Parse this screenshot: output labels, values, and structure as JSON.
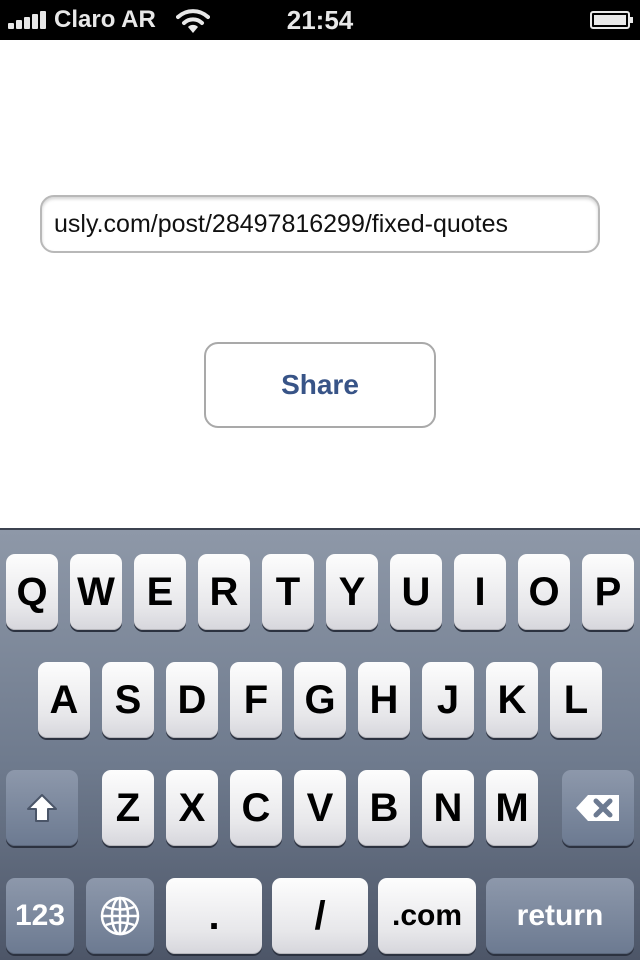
{
  "status_bar": {
    "carrier": "Claro AR",
    "time": "21:54",
    "icons": [
      "signal-strength-icon",
      "wifi-icon",
      "battery-icon"
    ]
  },
  "main": {
    "url_field": {
      "value": "usly.com/post/28497816299/fixed-quotes"
    },
    "share_button": {
      "label": "Share",
      "color": "#385487"
    }
  },
  "keyboard": {
    "row1": [
      "Q",
      "W",
      "E",
      "R",
      "T",
      "Y",
      "U",
      "I",
      "O",
      "P"
    ],
    "row2": [
      "A",
      "S",
      "D",
      "F",
      "G",
      "H",
      "J",
      "K",
      "L"
    ],
    "row3": [
      "Z",
      "X",
      "C",
      "V",
      "B",
      "N",
      "M"
    ],
    "row4": {
      "numbers": "123",
      "dot": ".",
      "slash": "/",
      "dotcom": ".com",
      "return": "return"
    },
    "icons": [
      "shift-icon",
      "backspace-icon",
      "globe-icon"
    ]
  }
}
